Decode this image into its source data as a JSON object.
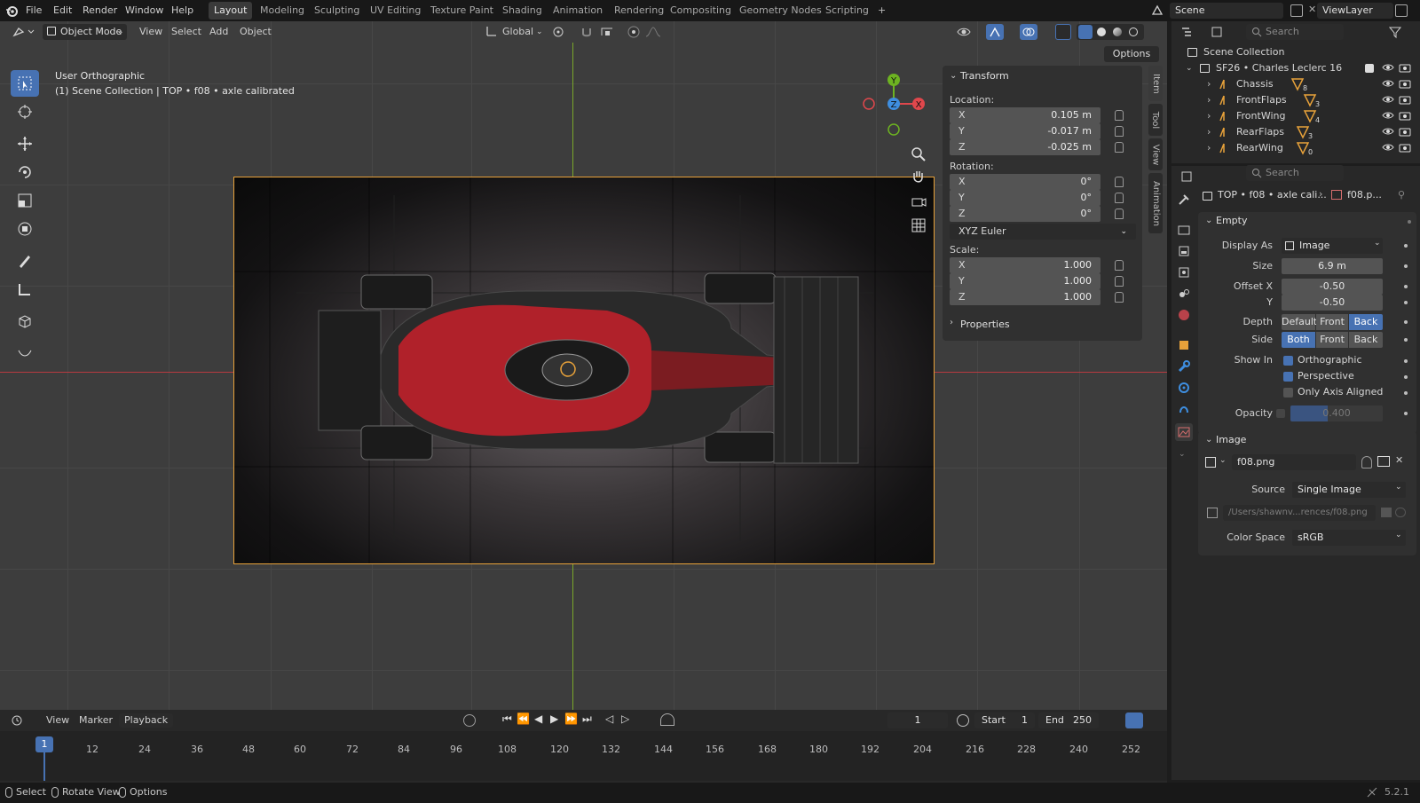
{
  "app": {
    "version": "5.2.1"
  },
  "menu": [
    "File",
    "Edit",
    "Render",
    "Window",
    "Help"
  ],
  "workspaces": [
    "Layout",
    "Modeling",
    "Sculpting",
    "UV Editing",
    "Texture Paint",
    "Shading",
    "Animation",
    "Rendering",
    "Compositing",
    "Geometry Nodes",
    "Scripting"
  ],
  "workspace_active": "Layout",
  "scene": {
    "name": "Scene",
    "view_layer": "ViewLayer"
  },
  "viewport": {
    "mode": "Object Mode",
    "menus": [
      "View",
      "Select",
      "Add",
      "Object"
    ],
    "orientation": "Global",
    "options_label": "Options",
    "view_name": "User Orthographic",
    "view_info": "(1) Scene Collection | TOP • f08 • axle calibrated",
    "gizmo_axes": {
      "x": "X",
      "y": "Y",
      "z": "Z"
    }
  },
  "colors": {
    "accent": "#4772b3",
    "x_axis": "#e0474c",
    "y_axis": "#6db321",
    "z_axis": "#3e8ee0",
    "selected_outline": "#e8a23a",
    "car_red": "#c8202a"
  },
  "npanel": {
    "title": "Transform",
    "location_label": "Location:",
    "location": [
      {
        "k": "X",
        "v": "0.105 m"
      },
      {
        "k": "Y",
        "v": "-0.017 m"
      },
      {
        "k": "Z",
        "v": "-0.025 m"
      }
    ],
    "rotation_label": "Rotation:",
    "rotation": [
      {
        "k": "X",
        "v": "0°"
      },
      {
        "k": "Y",
        "v": "0°"
      },
      {
        "k": "Z",
        "v": "0°"
      }
    ],
    "rotation_mode": "XYZ Euler",
    "scale_label": "Scale:",
    "scale": [
      {
        "k": "X",
        "v": "1.000"
      },
      {
        "k": "Y",
        "v": "1.000"
      },
      {
        "k": "Z",
        "v": "1.000"
      }
    ],
    "properties_label": "Properties",
    "tabs": [
      "Item",
      "Tool",
      "View",
      "Animation"
    ]
  },
  "outliner": {
    "search_placeholder": "Search",
    "root": "Scene Collection",
    "collection": "SF26 • Charles Leclerc 16",
    "items": [
      {
        "name": "Chassis",
        "count": "8"
      },
      {
        "name": "FrontFlaps",
        "count": "3"
      },
      {
        "name": "FrontWing",
        "count": "4"
      },
      {
        "name": "RearFlaps",
        "count": "3"
      },
      {
        "name": "RearWing",
        "count": "0"
      }
    ]
  },
  "properties": {
    "search_placeholder": "Search",
    "breadcrumb_object": "TOP • f08 • axle cali...",
    "breadcrumb_data": "f08.p...",
    "empty_panel": {
      "title": "Empty",
      "display_as_label": "Display As",
      "display_as": "Image",
      "size_label": "Size",
      "size": "6.9 m",
      "offset_x_label": "Offset X",
      "offset_x": "-0.50",
      "offset_y_label": "Y",
      "offset_y": "-0.50",
      "depth_label": "Depth",
      "depth_options": [
        "Default",
        "Front",
        "Back"
      ],
      "depth_selected": "Back",
      "side_label": "Side",
      "side_options": [
        "Both",
        "Front",
        "Back"
      ],
      "side_selected": "Both",
      "show_in_label": "Show In",
      "orthographic": "Orthographic",
      "perspective": "Perspective",
      "only_axis_aligned": "Only Axis Aligned",
      "opacity_label": "Opacity",
      "opacity": "0.400"
    },
    "image_panel": {
      "title": "Image",
      "image_name": "f08.png",
      "source_label": "Source",
      "source": "Single Image",
      "path": "/Users/shawnv...rences/f08.png",
      "color_space_label": "Color Space",
      "color_space": "sRGB"
    }
  },
  "timeline": {
    "menus": [
      "View",
      "Marker",
      "Playback"
    ],
    "current_frame": "1",
    "start_label": "Start",
    "start": "1",
    "end_label": "End",
    "end": "250",
    "ticks": [
      "12",
      "24",
      "36",
      "48",
      "60",
      "72",
      "84",
      "96",
      "108",
      "120",
      "132",
      "144",
      "156",
      "168",
      "180",
      "192",
      "204",
      "216",
      "228",
      "240",
      "252"
    ],
    "playhead": "1"
  },
  "status": {
    "select": "Select",
    "rotate": "Rotate View",
    "options": "Options",
    "version": "5.2.1"
  }
}
